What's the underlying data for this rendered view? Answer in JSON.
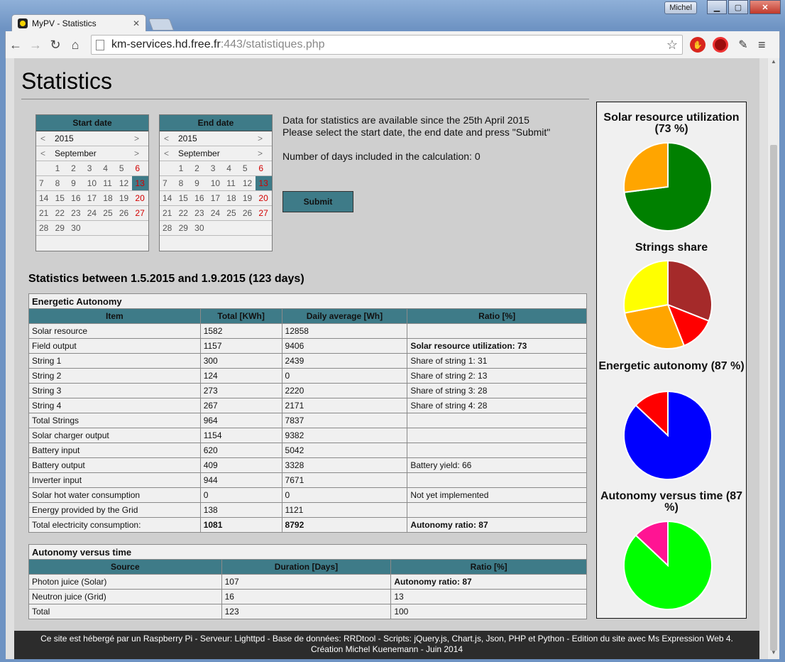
{
  "browser": {
    "user": "Michel",
    "tab_title": "MyPV - Statistics",
    "url_host": "km-services.hd.free.fr",
    "url_rest": ":443/statistiques.php"
  },
  "page": {
    "title": "Statistics",
    "calendars": [
      {
        "label": "Start date",
        "year": "2015",
        "month": "September"
      },
      {
        "label": "End date",
        "year": "2015",
        "month": "September"
      }
    ],
    "info_line1": "Data for statistics are available since the 25th April 2015",
    "info_line2": "Please select the start date, the end date and press \"Submit\"",
    "days_line": "Number of days included in the calculation: 0",
    "submit_label": "Submit",
    "stats_heading": "Statistics between 1.5.2015 and 1.9.2015 (123 days)"
  },
  "table1": {
    "caption": "Energetic Autonomy",
    "headers": [
      "Item",
      "Total [KWh]",
      "Daily average [Wh]",
      "Ratio [%]"
    ],
    "rows": [
      [
        "Solar resource",
        "1582",
        "12858",
        ""
      ],
      [
        "Field output",
        "1157",
        "9406",
        "Solar resource utilization: 73"
      ],
      [
        "String 1",
        "300",
        "2439",
        "Share of string 1: 31"
      ],
      [
        "String 2",
        "124",
        "0",
        "Share of string 2: 13"
      ],
      [
        "String 3",
        "273",
        "2220",
        "Share of string 3: 28"
      ],
      [
        "String 4",
        "267",
        "2171",
        "Share of string 4: 28"
      ],
      [
        "Total Strings",
        "964",
        "7837",
        ""
      ],
      [
        "Solar charger output",
        "1154",
        "9382",
        ""
      ],
      [
        "Battery input",
        "620",
        "5042",
        ""
      ],
      [
        "Battery output",
        "409",
        "3328",
        "Battery yield: 66"
      ],
      [
        "Inverter input",
        "944",
        "7671",
        ""
      ],
      [
        "Solar hot water consumption",
        "0",
        "0",
        "Not yet implemented"
      ],
      [
        "Energy provided by the Grid",
        "138",
        "1121",
        ""
      ],
      [
        "Total electricity consumption:",
        "1081",
        "8792",
        "Autonomy ratio: 87"
      ]
    ]
  },
  "table2": {
    "caption": "Autonomy versus time",
    "headers": [
      "Source",
      "Duration [Days]",
      "Ratio [%]"
    ],
    "rows": [
      [
        "Photon juice (Solar)",
        "107",
        "Autonomy ratio: 87"
      ],
      [
        "Neutron juice (Grid)",
        "16",
        "13"
      ],
      [
        "Total",
        "123",
        "100"
      ]
    ]
  },
  "chart_data": [
    {
      "type": "pie",
      "title": "Solar resource utilization (73 %)",
      "values": [
        73,
        27
      ],
      "colors": [
        "#008000",
        "#ffa500"
      ]
    },
    {
      "type": "pie",
      "title": "Strings share",
      "values": [
        31,
        13,
        28,
        28
      ],
      "colors": [
        "#a52a2a",
        "#ff0000",
        "#ffa500",
        "#ffff00"
      ]
    },
    {
      "type": "pie",
      "title": "Energetic autonomy (87 %)",
      "values": [
        87,
        13
      ],
      "colors": [
        "#0000ff",
        "#ff0000"
      ]
    },
    {
      "type": "pie",
      "title": "Autonomy versus time (87 %)",
      "values": [
        87,
        13
      ],
      "colors": [
        "#00ff00",
        "#ff1493"
      ]
    }
  ],
  "footer": {
    "line1": "Ce site est hébergé par un Raspberry Pi - Serveur: Lighttpd - Base de données: RRDtool - Scripts: jQuery.js, Chart.js, Json, PHP et Python - Edition du site avec Ms Expression Web 4.",
    "line2": "Création Michel Kuenemann - Juin 2014"
  }
}
